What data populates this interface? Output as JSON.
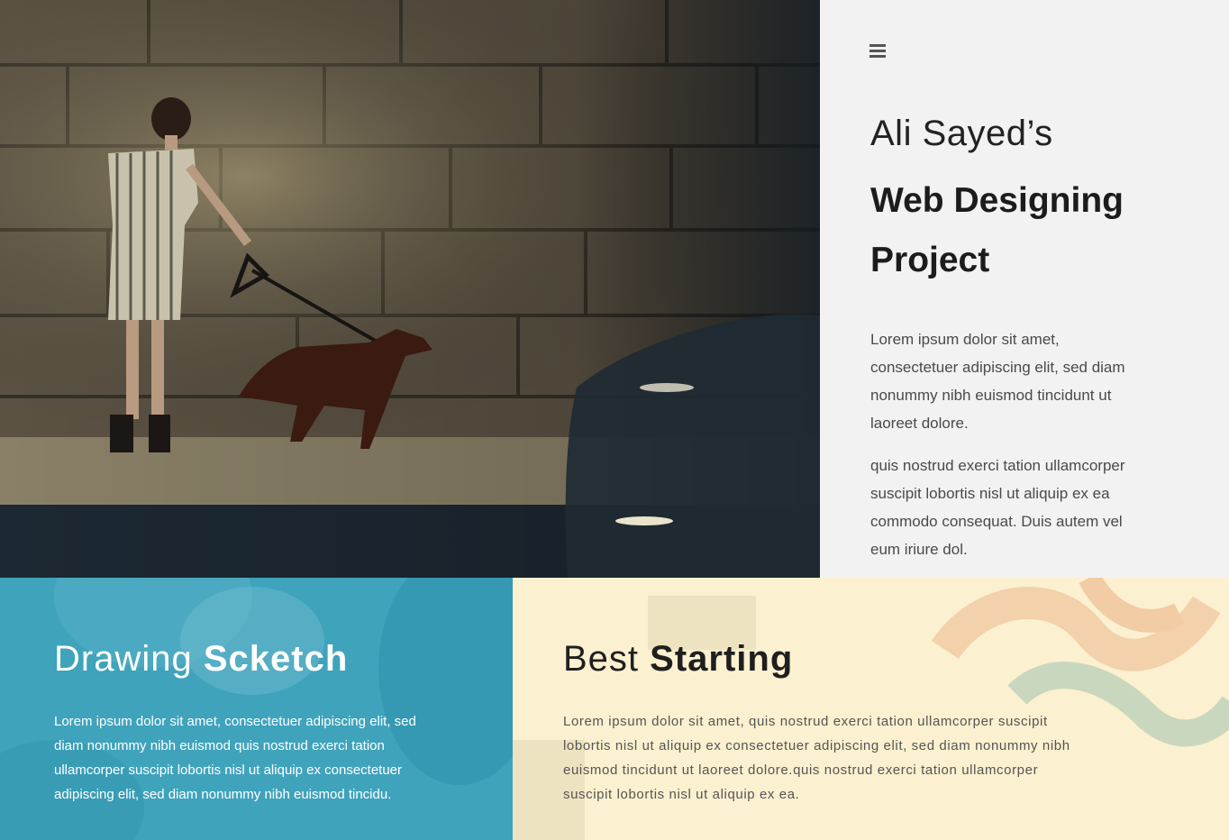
{
  "hero": {
    "image": "woman-walking-dog-photo"
  },
  "panel": {
    "menu_icon": "hamburger-menu-icon",
    "title_light": "Ali Sayed’s",
    "title_bold": "Web Designing Project",
    "paragraph_1": "Lorem ipsum dolor sit amet, consectetuer adipiscing elit, sed diam nonummy nibh euismod tincidunt ut laoreet dolore.",
    "paragraph_2": "quis nostrud exerci tation ullamcorper suscipit lobortis nisl ut aliquip ex ea commodo consequat. Duis autem vel eum iriure dol."
  },
  "drawing": {
    "title_light": "Drawing",
    "title_bold": "Scketch",
    "text": "Lorem ipsum dolor sit amet, consectetuer adipiscing elit, sed diam nonummy nibh euismod quis nostrud exerci tation ullamcorper suscipit lobortis nisl ut aliquip ex consectetuer adipiscing elit, sed diam nonummy nibh euismod tincidu.",
    "background_color": "#3fa3bc"
  },
  "starting": {
    "title_light": "Best",
    "title_bold": "Starting",
    "text": "Lorem ipsum dolor sit amet, quis nostrud exerci tation ullamcorper suscipit lobortis nisl ut aliquip ex consectetuer adipiscing elit, sed diam nonummy nibh euismod tincidunt ut laoreet dolore.quis nostrud exerci tation ullamcorper suscipit lobortis nisl ut aliquip ex ea.",
    "background_color": "#fbf0cf"
  }
}
